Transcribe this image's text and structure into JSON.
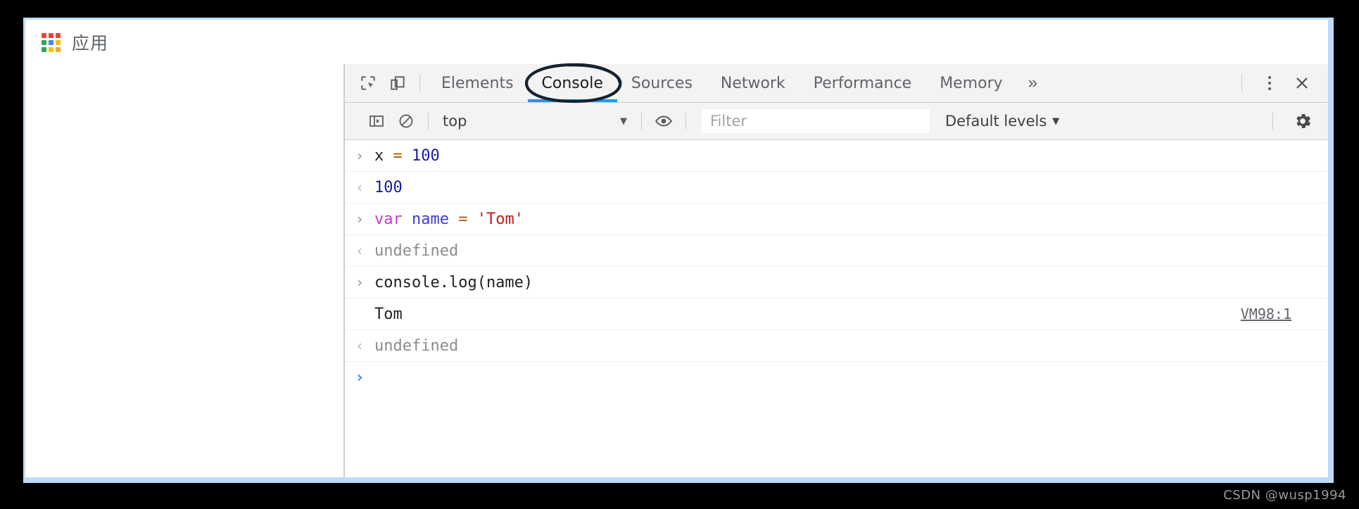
{
  "browser": {
    "bookmarks_bar": {
      "apps_icon": "apps-grid-icon",
      "apps_label": "应用",
      "apps_grid_colors": [
        "#ea4335",
        "#ea4335",
        "#ea4335",
        "#34a853",
        "#4285f4",
        "#fbbc05",
        "#34a853",
        "#fbbc05",
        "#f9a825"
      ]
    }
  },
  "devtools": {
    "toolbar_icons": {
      "inspect": "inspect-element-icon",
      "device": "device-toolbar-icon"
    },
    "tabs": [
      {
        "label": "Elements",
        "active": false
      },
      {
        "label": "Console",
        "active": true
      },
      {
        "label": "Sources",
        "active": false
      },
      {
        "label": "Network",
        "active": false
      },
      {
        "label": "Performance",
        "active": false
      },
      {
        "label": "Memory",
        "active": false
      }
    ],
    "more_tabs_label": "»",
    "kebab_label": "more-options",
    "close_label": "✕",
    "active_tab_underline_color": "#1a9bf0",
    "filterbar": {
      "sidebar_toggle": "console-sidebar-icon",
      "clear_label": "clear-console-icon",
      "context": "top",
      "context_caret": "▼",
      "eye_icon": "live-expression-icon",
      "filter_value": "",
      "filter_placeholder": "Filter",
      "levels": "Default levels",
      "levels_caret": "▼",
      "settings": "settings-gear-icon"
    },
    "console_messages": [
      {
        "kind": "input",
        "gutter": "›",
        "tokens": [
          {
            "t": "x ",
            "c": "tok-plain"
          },
          {
            "t": "= ",
            "c": "tok-op"
          },
          {
            "t": "100",
            "c": "tok-num"
          }
        ],
        "source": ""
      },
      {
        "kind": "output",
        "gutter": "‹",
        "tokens": [
          {
            "t": "100",
            "c": "tok-num"
          }
        ],
        "source": ""
      },
      {
        "kind": "input",
        "gutter": "›",
        "tokens": [
          {
            "t": "var ",
            "c": "tok-kw"
          },
          {
            "t": "name ",
            "c": "tok-var"
          },
          {
            "t": "= ",
            "c": "tok-op"
          },
          {
            "t": "'Tom'",
            "c": "tok-str"
          }
        ],
        "source": ""
      },
      {
        "kind": "output",
        "gutter": "‹",
        "tokens": [
          {
            "t": "undefined",
            "c": "tok-undef"
          }
        ],
        "source": ""
      },
      {
        "kind": "input",
        "gutter": "›",
        "tokens": [
          {
            "t": "console.log(name)",
            "c": "tok-plain"
          }
        ],
        "source": ""
      },
      {
        "kind": "log",
        "gutter": "",
        "tokens": [
          {
            "t": "Tom",
            "c": "tok-plain"
          }
        ],
        "source": "VM98:1"
      },
      {
        "kind": "output",
        "gutter": "‹",
        "tokens": [
          {
            "t": "undefined",
            "c": "tok-undef"
          }
        ],
        "source": ""
      },
      {
        "kind": "prompt",
        "gutter": "›",
        "tokens": [],
        "source": ""
      }
    ]
  },
  "annotation": {
    "shape": "hand-drawn-ellipse",
    "target": "Console",
    "color": "#16222e"
  },
  "watermark": "CSDN @wusp1994"
}
